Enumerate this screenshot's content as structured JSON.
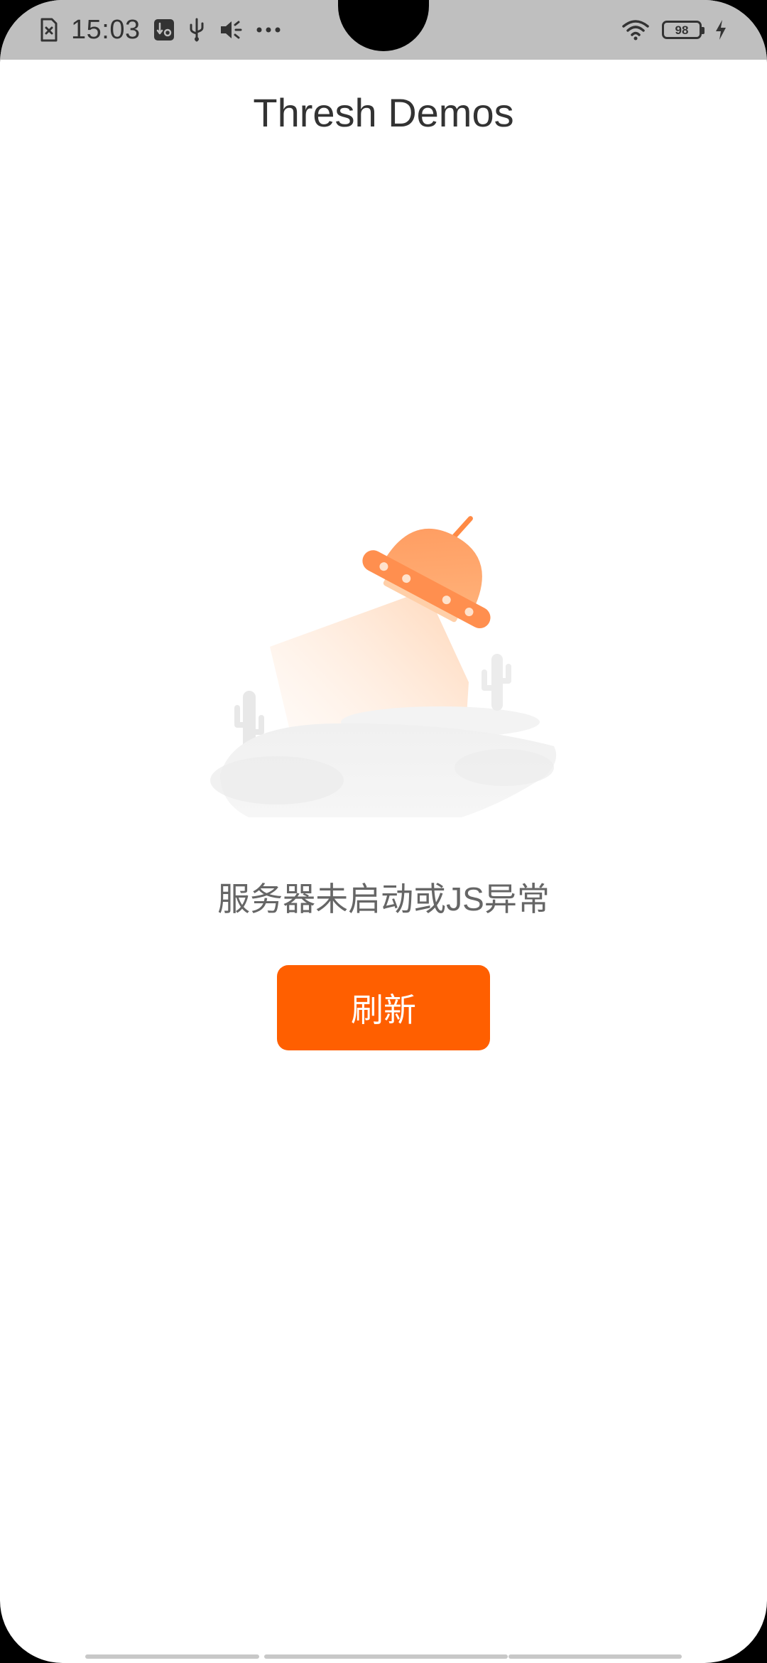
{
  "status_bar": {
    "time": "15:03",
    "battery_level": "98",
    "icons_left": [
      "sim-card-error-icon",
      "usb-debug-icon",
      "usb-icon",
      "volume-icon",
      "more-dots-icon"
    ],
    "icons_right": [
      "wifi-icon",
      "battery-icon",
      "charging-icon"
    ]
  },
  "header": {
    "title": "Thresh Demos"
  },
  "main": {
    "illustration": "ufo-error-illustration",
    "message": "服务器未启动或JS异常",
    "refresh_label": "刷新"
  },
  "colors": {
    "accent": "#ff5f00",
    "title_text": "#333333",
    "message_text": "#666666",
    "status_bar_bg": "#bfbfbf"
  }
}
